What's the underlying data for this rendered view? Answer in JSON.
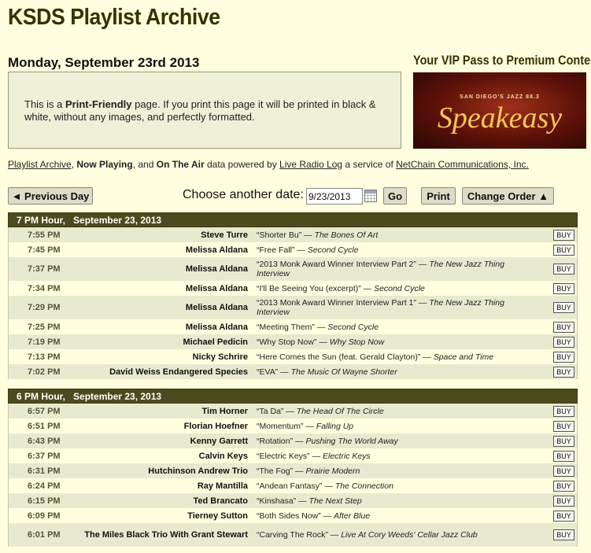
{
  "header": {
    "site_title": "KSDS Playlist Archive",
    "date_heading": "Monday, September 23rd 2013"
  },
  "print_notice": {
    "pre": "This is a ",
    "bold": "Print-Friendly",
    "post": " page. If you print this page it will be printed in black & white, without any images, and perfectly formatted."
  },
  "ad": {
    "headline": "Your VIP Pass to Premium Content",
    "sub": "SAN DIEGO'S JAZZ 88.3",
    "main": "Speakeasy"
  },
  "credits": {
    "playlist_archive": "Playlist Archive",
    "sep1": ", ",
    "now_playing": "Now Playing",
    "sep2": ", and ",
    "on_the_air": "On The Air",
    "mid": " data powered by ",
    "live_radio_log": "Live Radio Log",
    "mid2": " a service of ",
    "netchain": "NetChain Communications, Inc."
  },
  "controls": {
    "prev_day": "◄ Previous Day",
    "choose_label": "Choose another date:",
    "date_value": "9/23/2013",
    "go": "Go",
    "print": "Print",
    "change_order": "Change Order ▲"
  },
  "hours": [
    {
      "label": "7 PM Hour,",
      "date": "September 23, 2013",
      "rows": [
        {
          "time": "7:55 PM",
          "artist": "Steve Turre",
          "song": "“Shorter Bu”",
          "album": "The Bones Of Art",
          "buy": "BUY"
        },
        {
          "time": "7:45 PM",
          "artist": "Melissa Aldana",
          "song": "“Free Fall”",
          "album": "Second Cycle",
          "buy": "BUY"
        },
        {
          "time": "7:37 PM",
          "artist": "Melissa Aldana",
          "song": "“2013 Monk Award Winner Interview Part 2”",
          "album": "The New Jazz Thing Interview",
          "buy": "BUY",
          "tall": true
        },
        {
          "time": "7:34 PM",
          "artist": "Melissa Aldana",
          "song": "“I'll Be Seeing You (excerpt)”",
          "album": "Second Cycle",
          "buy": "BUY"
        },
        {
          "time": "7:29 PM",
          "artist": "Melissa Aldana",
          "song": "“2013 Monk Award Winner Interview Part 1”",
          "album": "The New Jazz Thing Interview",
          "buy": "BUY",
          "tall": true
        },
        {
          "time": "7:25 PM",
          "artist": "Melissa Aldana",
          "song": "“Meeting Them”",
          "album": "Second Cycle",
          "buy": "BUY"
        },
        {
          "time": "7:19 PM",
          "artist": "Michael Pedicin",
          "song": "“Why Stop Now”",
          "album": "Why Stop Now",
          "buy": "BUY"
        },
        {
          "time": "7:13 PM",
          "artist": "Nicky Schrire",
          "song": "“Here Comes the Sun (feat. Gerald Clayton)”",
          "album": "Space and Time",
          "buy": "BUY"
        },
        {
          "time": "7:02 PM",
          "artist": "David Weiss Endangered Species",
          "song": "“EVA”",
          "album": "The Music Of Wayne Shorter",
          "buy": "BUY"
        }
      ]
    },
    {
      "label": "6 PM Hour,",
      "date": "September 23, 2013",
      "rows": [
        {
          "time": "6:57 PM",
          "artist": "Tim Horner",
          "song": "“Ta Da”",
          "album": "The Head Of The Circle",
          "buy": "BUY"
        },
        {
          "time": "6:51 PM",
          "artist": "Florian Hoefner",
          "song": "“Momentum”",
          "album": "Falling Up",
          "buy": "BUY"
        },
        {
          "time": "6:43 PM",
          "artist": "Kenny Garrett",
          "song": "“Rotation”",
          "album": "Pushing The World Away",
          "buy": "BUY"
        },
        {
          "time": "6:37 PM",
          "artist": "Calvin Keys",
          "song": "“Electric Keys”",
          "album": "Electric Keys",
          "buy": "BUY"
        },
        {
          "time": "6:31 PM",
          "artist": "Hutchinson Andrew Trio",
          "song": "“The Fog”",
          "album": "Prairie Modern",
          "buy": "BUY"
        },
        {
          "time": "6:24 PM",
          "artist": "Ray Mantilla",
          "song": "“Andean Fantasy”",
          "album": "The Connection",
          "buy": "BUY"
        },
        {
          "time": "6:15 PM",
          "artist": "Ted Brancato",
          "song": "“Kinshasa”",
          "album": "The Next Step",
          "buy": "BUY"
        },
        {
          "time": "6:09 PM",
          "artist": "Tierney Sutton",
          "song": "“Both Sides Now”",
          "album": "After Blue",
          "buy": "BUY"
        },
        {
          "time": "6:01 PM",
          "artist": "The Miles Black Trio With Grant Stewart",
          "song": "“Carving The Rock”",
          "album": "Live At Cory Weeds' Cellar Jazz Club",
          "buy": "BUY",
          "tall": true
        }
      ]
    }
  ]
}
